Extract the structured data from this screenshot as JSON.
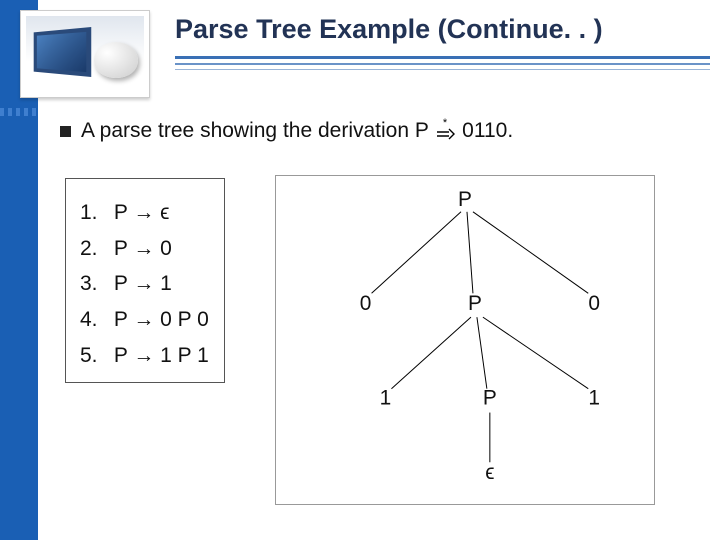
{
  "title": "Parse Tree Example (Continue. . )",
  "bullet": {
    "prefix": "A parse tree showing the derivation P ",
    "suffix": " 0110."
  },
  "grammar": {
    "rows": [
      {
        "n": "1.",
        "lhs": "P",
        "rhs": "ϵ"
      },
      {
        "n": "2.",
        "lhs": "P",
        "rhs": "0"
      },
      {
        "n": "3.",
        "lhs": "P",
        "rhs": "1"
      },
      {
        "n": "4.",
        "lhs": "P",
        "rhs": "0 P 0"
      },
      {
        "n": "5.",
        "lhs": "P",
        "rhs": "1 P 1"
      }
    ]
  },
  "tree": {
    "nodes": {
      "root": "P",
      "l1_left": "0",
      "l1_mid": "P",
      "l1_right": "0",
      "l2_left": "1",
      "l2_mid": "P",
      "l2_right": "1",
      "l3": "ϵ"
    }
  }
}
